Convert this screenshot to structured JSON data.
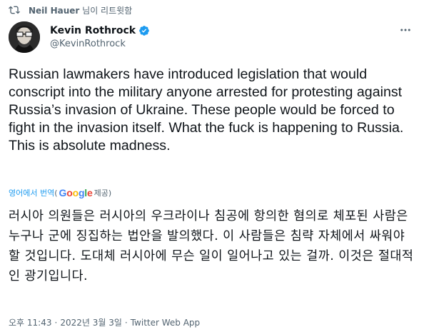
{
  "retweet": {
    "retweeter": "Neil Hauer",
    "suffix": "님이 리트윗함"
  },
  "author": {
    "name": "Kevin Rothrock",
    "handle": "@KevinRothrock",
    "verified": true
  },
  "tweet": {
    "text": "Russian lawmakers have introduced legislation that would conscript into the military anyone arrested for protesting against Russia’s invasion of Ukraine. These people would be forced to fight in the invasion itself. What the fuck is happening to Russia. This is absolute madness."
  },
  "translation": {
    "link_label": "영어에서 번역",
    "open_paren": "(",
    "provider": "Google",
    "provided_by": "제공)",
    "text": "러시아 의원들은 러시아의 우크라이나 침공에 항의한 혐의로 체포된 사람은 누구나 군에 징집하는 법안을 발의했다. 이 사람들은 침략 자체에서 싸워야 할 것입니다. 도대체 러시아에 무슨 일이 일어나고 있는 걸까. 이것은 절대적인 광기입니다."
  },
  "meta": {
    "time": "오후 11:43",
    "date": "2022년 3월 3일",
    "source": "Twitter Web App",
    "separator": "·"
  },
  "colors": {
    "link": "#1d9bf0",
    "secondary_text": "#536471",
    "verified": "#1d9bf0"
  },
  "icons": [
    "retweet-icon",
    "verified-badge-icon",
    "more-options-icon"
  ]
}
